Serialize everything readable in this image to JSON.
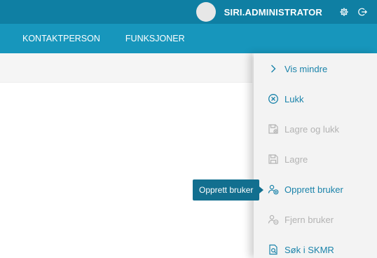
{
  "header": {
    "username": "SIRI.ADMINISTRATOR",
    "icons": [
      "settings-icon",
      "logout-icon"
    ]
  },
  "nav": {
    "items": [
      "KONTAKTPERSON",
      "FUNKSJONER"
    ]
  },
  "panel": {
    "actions": [
      {
        "label": "Vis mindre",
        "icon": "chevron-right-icon",
        "enabled": true
      },
      {
        "label": "Lukk",
        "icon": "close-circle-icon",
        "enabled": true
      },
      {
        "label": "Lagre og lukk",
        "icon": "save-close-icon",
        "enabled": false
      },
      {
        "label": "Lagre",
        "icon": "save-icon",
        "enabled": false
      },
      {
        "label": "Opprett bruker",
        "icon": "add-user-icon",
        "enabled": true
      },
      {
        "label": "Fjern bruker",
        "icon": "remove-user-icon",
        "enabled": false
      },
      {
        "label": "Søk i SKMR",
        "icon": "search-document-icon",
        "enabled": true
      }
    ]
  },
  "tooltip": {
    "text": "Opprett bruker"
  },
  "colors": {
    "topbar": "#0f7fa3",
    "navbar": "#1796bc",
    "accent": "#1a83aa",
    "disabled": "#b3b3b3",
    "tooltip": "#126f8f"
  }
}
